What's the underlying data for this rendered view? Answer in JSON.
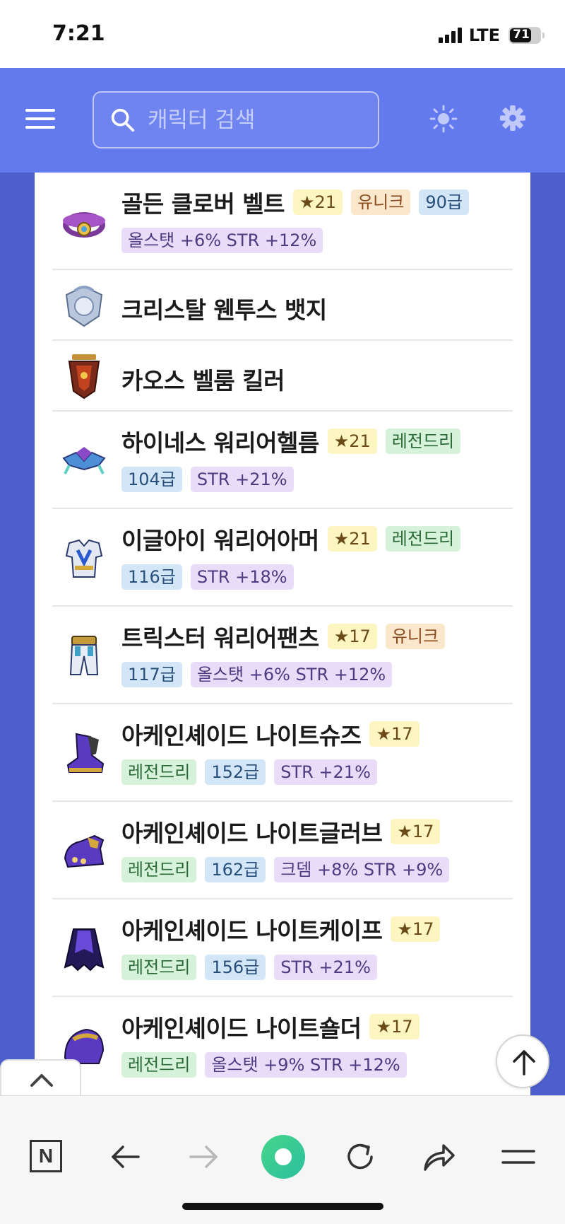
{
  "status": {
    "time": "7:21",
    "network": "LTE",
    "battery": "71"
  },
  "header": {
    "search_placeholder": "캐릭터 검색",
    "icons": [
      "menu-icon",
      "search-icon",
      "sun-icon",
      "gear-icon"
    ]
  },
  "items": [
    {
      "name": "골든 클로버 벨트",
      "star": "★21",
      "grade": "유니크",
      "grade_type": "unique",
      "tags": [
        {
          "text": "90급",
          "type": "level"
        }
      ],
      "stat": "올스탯 +6% STR +12%"
    },
    {
      "name": "크리스탈 웬투스 뱃지"
    },
    {
      "name": "카오스 벨룸 킬러"
    },
    {
      "name": "하이네스 워리어헬름",
      "star": "★21",
      "grade": "레전드리",
      "grade_type": "legend",
      "tags": [
        {
          "text": "104급",
          "type": "level"
        }
      ],
      "stat": "STR +21%"
    },
    {
      "name": "이글아이 워리어아머",
      "star": "★21",
      "grade": "레전드리",
      "grade_type": "legend",
      "tags": [
        {
          "text": "116급",
          "type": "level"
        }
      ],
      "stat": "STR +18%"
    },
    {
      "name": "트릭스터 워리어팬츠",
      "star": "★17",
      "grade": "유니크",
      "grade_type": "unique",
      "tags": [
        {
          "text": "117급",
          "type": "level"
        }
      ],
      "stat": "올스탯 +6% STR +12%"
    },
    {
      "name": "아케인셰이드 나이트슈즈",
      "star": "★17",
      "tags": [
        {
          "text": "레전드리",
          "type": "legend"
        },
        {
          "text": "152급",
          "type": "level"
        }
      ],
      "stat": "STR +21%"
    },
    {
      "name": "아케인셰이드 나이트글러브",
      "star": "★17",
      "tags": [
        {
          "text": "레전드리",
          "type": "legend"
        },
        {
          "text": "162급",
          "type": "level"
        }
      ],
      "stat": "크뎀 +8% STR +9%"
    },
    {
      "name": "아케인셰이드 나이트케이프",
      "star": "★17",
      "tags": [
        {
          "text": "레전드리",
          "type": "legend"
        },
        {
          "text": "156급",
          "type": "level"
        }
      ],
      "stat": "STR +21%"
    },
    {
      "name": "아케인셰이드 나이트숄더",
      "star": "★17",
      "tags": [
        {
          "text": "레전드리",
          "type": "legend"
        }
      ],
      "stat": "올스탯 +9% STR +12%"
    }
  ],
  "toolbar": {
    "n_label": "N",
    "icons": [
      "n-icon",
      "back-arrow-icon",
      "forward-arrow-icon",
      "record-icon",
      "reload-icon",
      "share-icon",
      "menu-lines-icon"
    ]
  },
  "colors": {
    "header": "#6379ee",
    "side_bg": "#4c5fcc",
    "star_tag": "#fdf6c3",
    "unique_tag": "#fbe7cc",
    "legend_tag": "#d6f2da",
    "level_tag": "#d2e6f8",
    "stat_tag": "#e8dcf8"
  }
}
